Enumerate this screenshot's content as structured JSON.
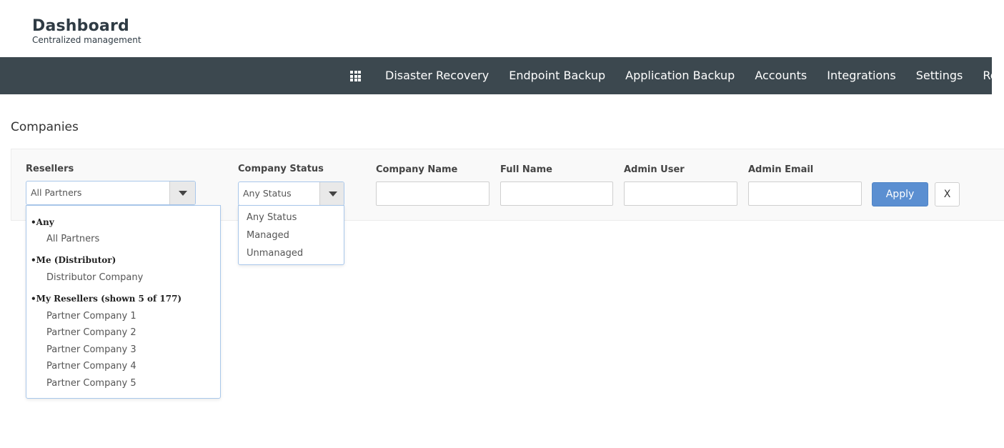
{
  "header": {
    "title": "Dashboard",
    "subtitle": "Centralized management"
  },
  "nav": {
    "apps_icon": "grid-icon",
    "items": [
      "Disaster Recovery",
      "Endpoint Backup",
      "Application Backup",
      "Accounts",
      "Integrations",
      "Settings",
      "Resources"
    ]
  },
  "page": {
    "title": "Companies"
  },
  "filters": {
    "resellers": {
      "label": "Resellers",
      "value": "All Partners",
      "groups": [
        {
          "title": "Any",
          "options": [
            "All Partners"
          ]
        },
        {
          "title": "Me (Distributor)",
          "options": [
            "Distributor Company"
          ]
        },
        {
          "title": "My Resellers (shown 5 of 177)",
          "options": [
            "Partner Company 1",
            "Partner Company 2",
            "Partner Company 3",
            "Partner Company 4",
            "Partner Company 5"
          ]
        }
      ]
    },
    "status": {
      "label": "Company Status",
      "value": "Any Status",
      "options": [
        "Any Status",
        "Managed",
        "Unmanaged"
      ]
    },
    "company_name": {
      "label": "Company Name",
      "value": ""
    },
    "full_name": {
      "label": "Full Name",
      "value": ""
    },
    "admin_user": {
      "label": "Admin User",
      "value": ""
    },
    "admin_email": {
      "label": "Admin Email",
      "value": ""
    },
    "apply_label": "Apply",
    "clear_label": "X"
  },
  "colors": {
    "navbar": "#3c484f",
    "accent": "#5b8fd1"
  }
}
